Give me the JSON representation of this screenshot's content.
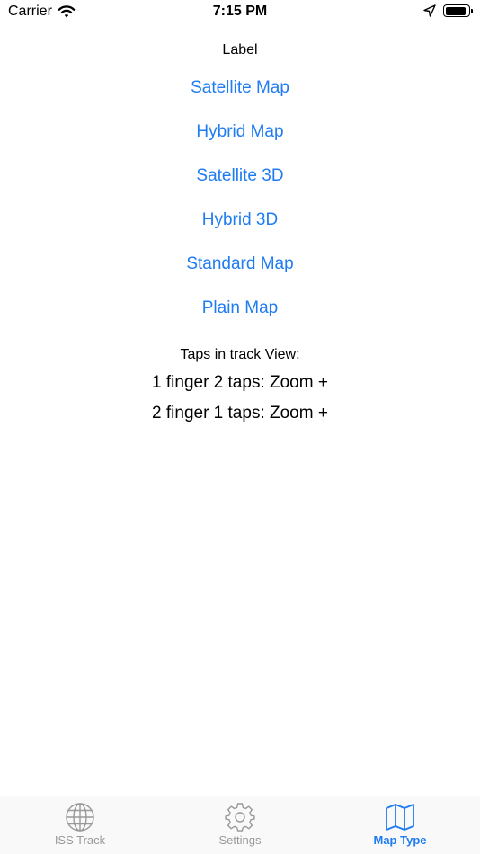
{
  "status_bar": {
    "carrier": "Carrier",
    "time": "7:15 PM",
    "battery_level": 0.95
  },
  "main": {
    "label": "Label",
    "map_buttons": [
      "Satellite Map",
      "Hybrid Map",
      "Satellite 3D",
      "Hybrid 3D",
      "Standard Map",
      "Plain Map"
    ],
    "taps_title": "Taps in track View:",
    "tap_lines": [
      "1 finger 2 taps: Zoom +",
      "2 finger 1 taps: Zoom +"
    ]
  },
  "tab_bar": {
    "tabs": [
      {
        "label": "ISS Track",
        "icon": "globe-icon",
        "active": false
      },
      {
        "label": "Settings",
        "icon": "gear-icon",
        "active": false
      },
      {
        "label": "Map Type",
        "icon": "map-icon",
        "active": true
      }
    ]
  },
  "colors": {
    "accent": "#1f7cf2",
    "inactive": "#999999"
  }
}
